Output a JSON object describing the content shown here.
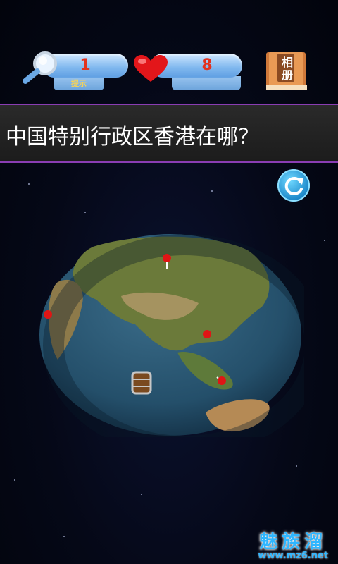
{
  "hud": {
    "hints_count": "1",
    "hints_label": "提示",
    "lives_count": "8",
    "album_label": "相册"
  },
  "question": {
    "text": "中国特别行政区香港在哪？"
  },
  "globe": {
    "markers_count": 4
  },
  "watermark": {
    "brand": "魅族溜",
    "url": "www.mz6.net"
  },
  "colors": {
    "pill": "#7fb7ee",
    "counter_text": "#e3321e",
    "question_border": "#8a3db3",
    "refresh": "#1a86c8",
    "marker": "#e01515"
  },
  "icons": [
    "magnifier-icon",
    "heart-icon",
    "book-icon",
    "refresh-icon",
    "barrel-icon",
    "pin-icon"
  ]
}
